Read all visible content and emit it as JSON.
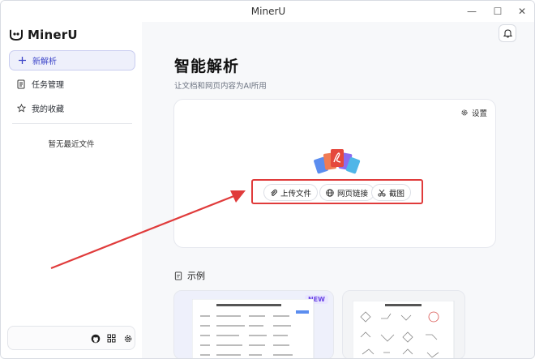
{
  "window": {
    "title": "MinerU",
    "minimize_symbol": "—",
    "maximize_symbol": "☐",
    "close_symbol": "✕"
  },
  "sidebar": {
    "logo_text": "MinerU",
    "items": [
      {
        "label": "新解析",
        "icon": "plus-icon",
        "active": true
      },
      {
        "label": "任务管理",
        "icon": "document-icon",
        "active": false
      },
      {
        "label": "我的收藏",
        "icon": "star-icon",
        "active": false
      }
    ],
    "empty_recent": "暂无最近文件",
    "footer_icons": [
      "github-icon",
      "grid-icon",
      "gear-icon"
    ]
  },
  "main": {
    "title": "智能解析",
    "subtitle": "让文档和网页内容为AI所用",
    "settings_label": "设置",
    "actions": [
      {
        "label": "上传文件",
        "icon": "paperclip-icon"
      },
      {
        "label": "网页链接",
        "icon": "globe-icon"
      },
      {
        "label": "截图",
        "icon": "scissors-icon"
      }
    ],
    "examples_title": "示例",
    "example_badge": "NEW"
  },
  "colors": {
    "accent": "#3d46c9",
    "annotation_red": "#e03b3b",
    "badge_purple": "#6b46e5"
  }
}
